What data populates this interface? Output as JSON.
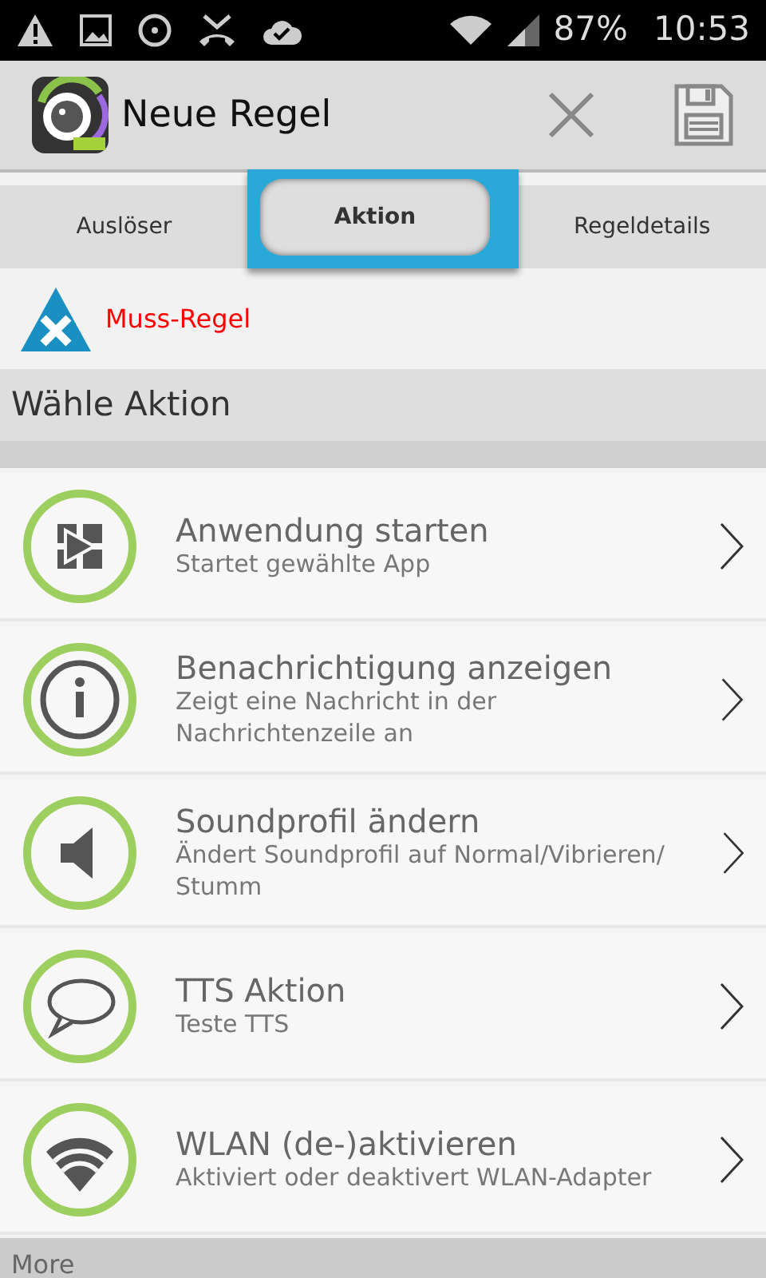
{
  "status_bar": {
    "battery": "87%",
    "time": "10:53"
  },
  "action_bar": {
    "title": "Neue Regel"
  },
  "tabs": [
    {
      "label": "Auslöser",
      "selected": false
    },
    {
      "label": "Aktion",
      "selected": true
    },
    {
      "label": "Regeldetails",
      "selected": false
    }
  ],
  "rule_type": {
    "label": "Muss-Regel"
  },
  "section_title": "Wähle Aktion",
  "actions": [
    {
      "kind": "apps",
      "title": "Anwendung starten",
      "subtitle": "Startet gewählte App"
    },
    {
      "kind": "info",
      "title": "Benachrichtigung anzeigen",
      "subtitle": "Zeigt eine Nachricht in der Nachrichtenzeile an"
    },
    {
      "kind": "sound",
      "title": "Soundprofil ändern",
      "subtitle": "Ändert Soundprofil auf Normal/Vibrieren/ Stumm"
    },
    {
      "kind": "speech",
      "title": "TTS Aktion",
      "subtitle": "Teste TTS"
    },
    {
      "kind": "wifi",
      "title": "WLAN (de-)aktivieren",
      "subtitle": "Aktiviert oder deaktivert WLAN-Adapter"
    }
  ],
  "next_group": "More"
}
